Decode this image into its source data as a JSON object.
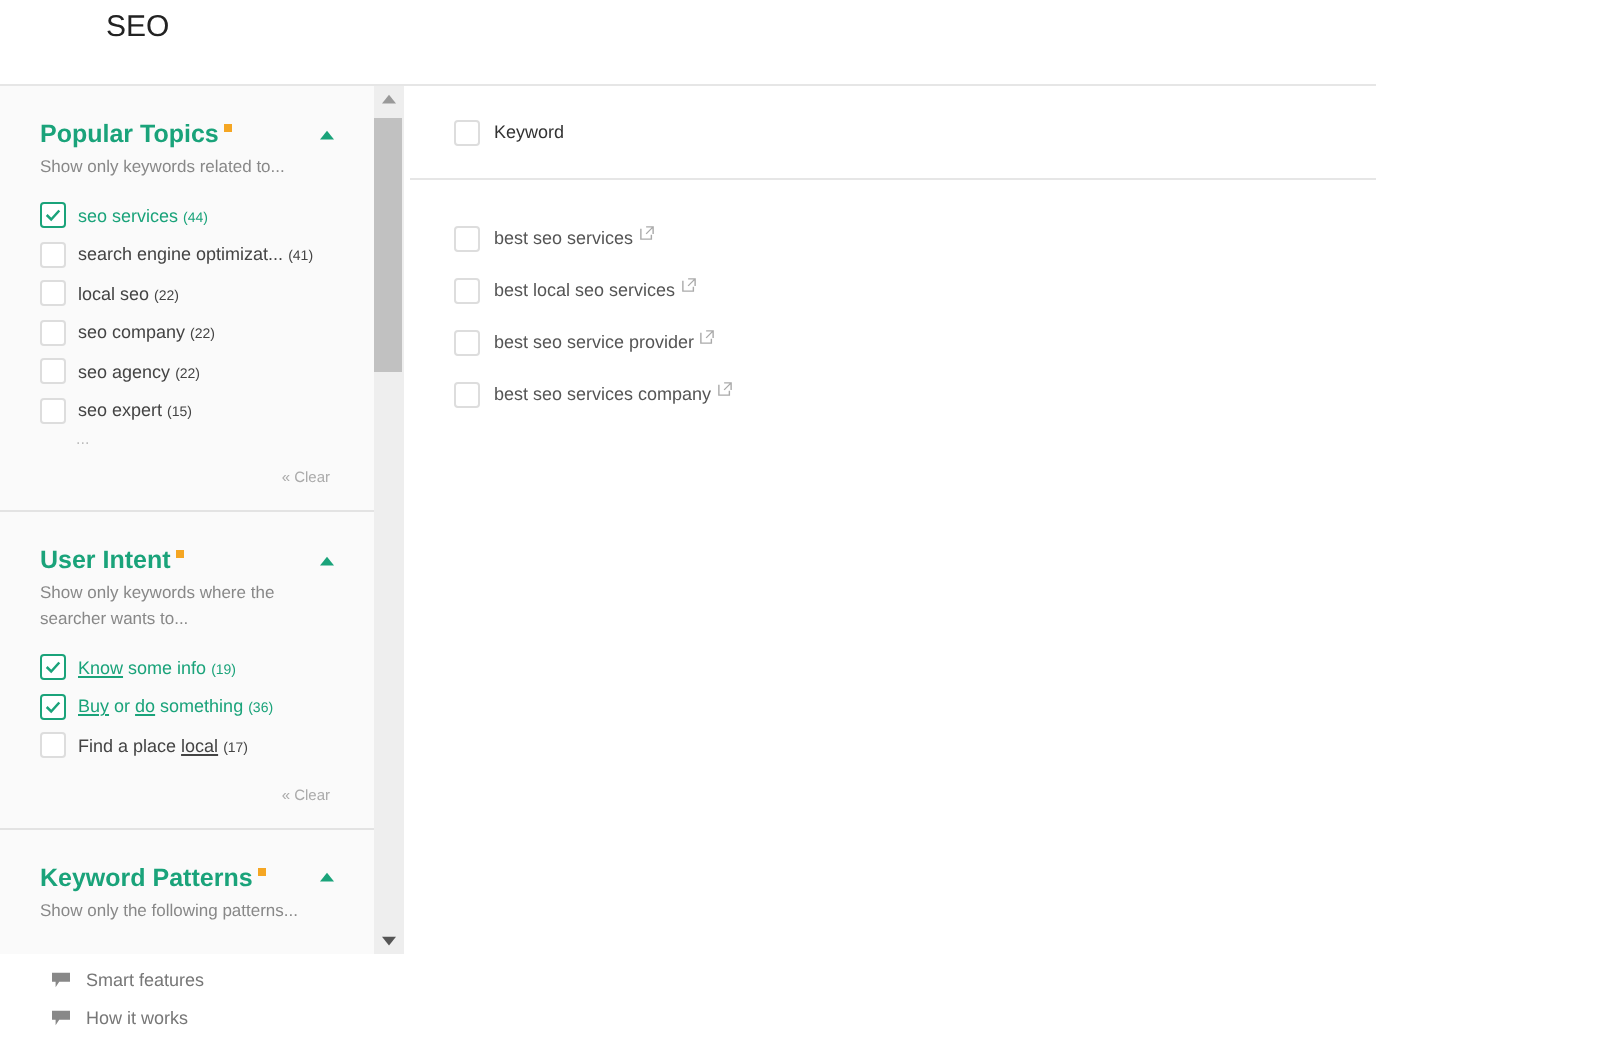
{
  "page": {
    "title": "SEO"
  },
  "filters": [
    {
      "title": "Popular Topics",
      "required": true,
      "expanded": true,
      "description": "Show only keywords related to...",
      "options": [
        {
          "parts": [
            {
              "text": "seo services",
              "underline": false
            }
          ],
          "count": "(44)",
          "checked": true
        },
        {
          "parts": [
            {
              "text": "search engine optimizat...",
              "underline": false
            }
          ],
          "count": "(41)",
          "checked": false
        },
        {
          "parts": [
            {
              "text": "local seo",
              "underline": false
            }
          ],
          "count": "(22)",
          "checked": false
        },
        {
          "parts": [
            {
              "text": "seo company",
              "underline": false
            }
          ],
          "count": "(22)",
          "checked": false
        },
        {
          "parts": [
            {
              "text": "seo agency",
              "underline": false
            }
          ],
          "count": "(22)",
          "checked": false
        },
        {
          "parts": [
            {
              "text": "seo expert",
              "underline": false
            }
          ],
          "count": "(15)",
          "checked": false
        }
      ],
      "more": "...",
      "clear": "« Clear"
    },
    {
      "title": "User Intent",
      "required": true,
      "expanded": true,
      "description": "Show only keywords where the searcher wants to...",
      "options": [
        {
          "parts": [
            {
              "text": "Know",
              "underline": true
            },
            {
              "text": " some info",
              "underline": false
            }
          ],
          "count": "(19)",
          "checked": true
        },
        {
          "parts": [
            {
              "text": "Buy",
              "underline": true
            },
            {
              "text": " or ",
              "underline": false
            },
            {
              "text": "do",
              "underline": true
            },
            {
              "text": " something",
              "underline": false
            }
          ],
          "count": "(36)",
          "checked": true
        },
        {
          "parts": [
            {
              "text": "Find a place ",
              "underline": false
            },
            {
              "text": "local",
              "underline": true
            }
          ],
          "count": "(17)",
          "checked": false
        }
      ],
      "clear": "« Clear"
    },
    {
      "title": "Keyword Patterns",
      "required": true,
      "expanded": true,
      "description": "Show only the following patterns..."
    }
  ],
  "footer_links": [
    {
      "label": "Smart features"
    },
    {
      "label": "How it works"
    }
  ],
  "table": {
    "header": {
      "label": "Keyword",
      "checked": false
    },
    "rows": [
      {
        "keyword": "best seo services",
        "checked": false
      },
      {
        "keyword": "best local seo services",
        "checked": false
      },
      {
        "keyword": "best seo service provider",
        "checked": false
      },
      {
        "keyword": "best seo services company",
        "checked": false
      }
    ]
  }
}
